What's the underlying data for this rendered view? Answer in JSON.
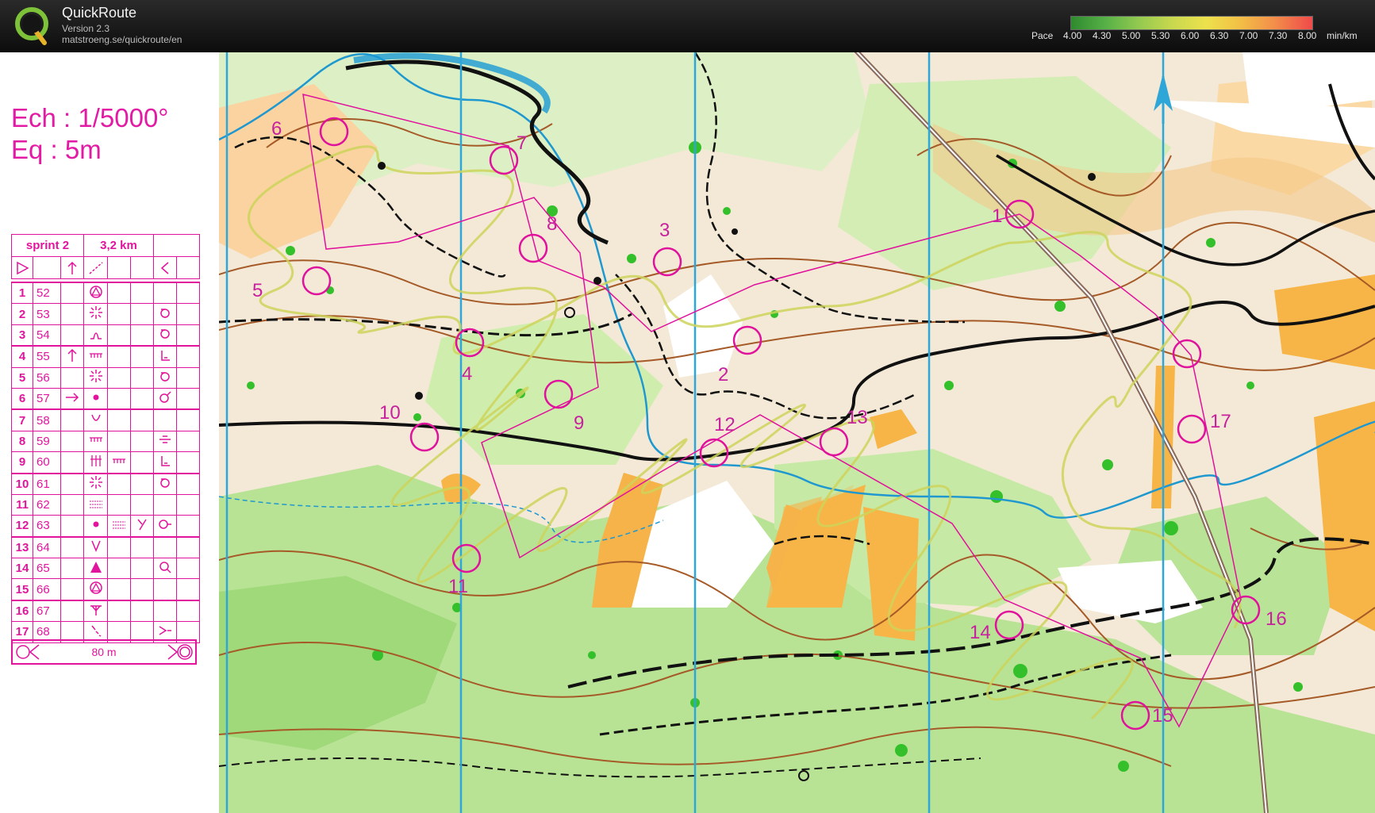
{
  "app": {
    "title": "QuickRoute",
    "version": "Version 2.3",
    "url": "matstroeng.se/quickroute/en"
  },
  "pace_scale": {
    "prefix": "Pace",
    "ticks": [
      "4.00",
      "4.30",
      "5.00",
      "5.30",
      "6.00",
      "6.30",
      "7.00",
      "7.30",
      "8.00"
    ],
    "unit": "min/km",
    "colors": [
      "#2f8a2f",
      "#55b046",
      "#93c950",
      "#c9d84e",
      "#ece14c",
      "#f3bf46",
      "#f38f4a",
      "#ef4a4a"
    ]
  },
  "map_legend": {
    "scale": "Ech : 1/5000°",
    "equidistance": "Eq : 5m"
  },
  "description_sheet": {
    "event": "sprint 2",
    "length": "3,2 km",
    "finish_distance": "80 m",
    "controls": [
      {
        "n": "1",
        "code": "52"
      },
      {
        "n": "2",
        "code": "53"
      },
      {
        "n": "3",
        "code": "54"
      },
      {
        "n": "4",
        "code": "55"
      },
      {
        "n": "5",
        "code": "56"
      },
      {
        "n": "6",
        "code": "57"
      },
      {
        "n": "7",
        "code": "58"
      },
      {
        "n": "8",
        "code": "59"
      },
      {
        "n": "9",
        "code": "60"
      },
      {
        "n": "10",
        "code": "61"
      },
      {
        "n": "11",
        "code": "62"
      },
      {
        "n": "12",
        "code": "63"
      },
      {
        "n": "13",
        "code": "64"
      },
      {
        "n": "14",
        "code": "65"
      },
      {
        "n": "15",
        "code": "66"
      },
      {
        "n": "16",
        "code": "67"
      },
      {
        "n": "17",
        "code": "68"
      }
    ]
  },
  "map_controls": [
    "1",
    "2",
    "3",
    "4",
    "5",
    "6",
    "7",
    "8",
    "9",
    "10",
    "11",
    "12",
    "13",
    "14",
    "15",
    "16",
    "17"
  ],
  "colors": {
    "course": "#e0119c",
    "meridian": "#2fa6d8",
    "open_land": "#f5c27c",
    "forest": "#8cd86a",
    "green_dense": "#33c02a",
    "contour": "#a55a28"
  }
}
